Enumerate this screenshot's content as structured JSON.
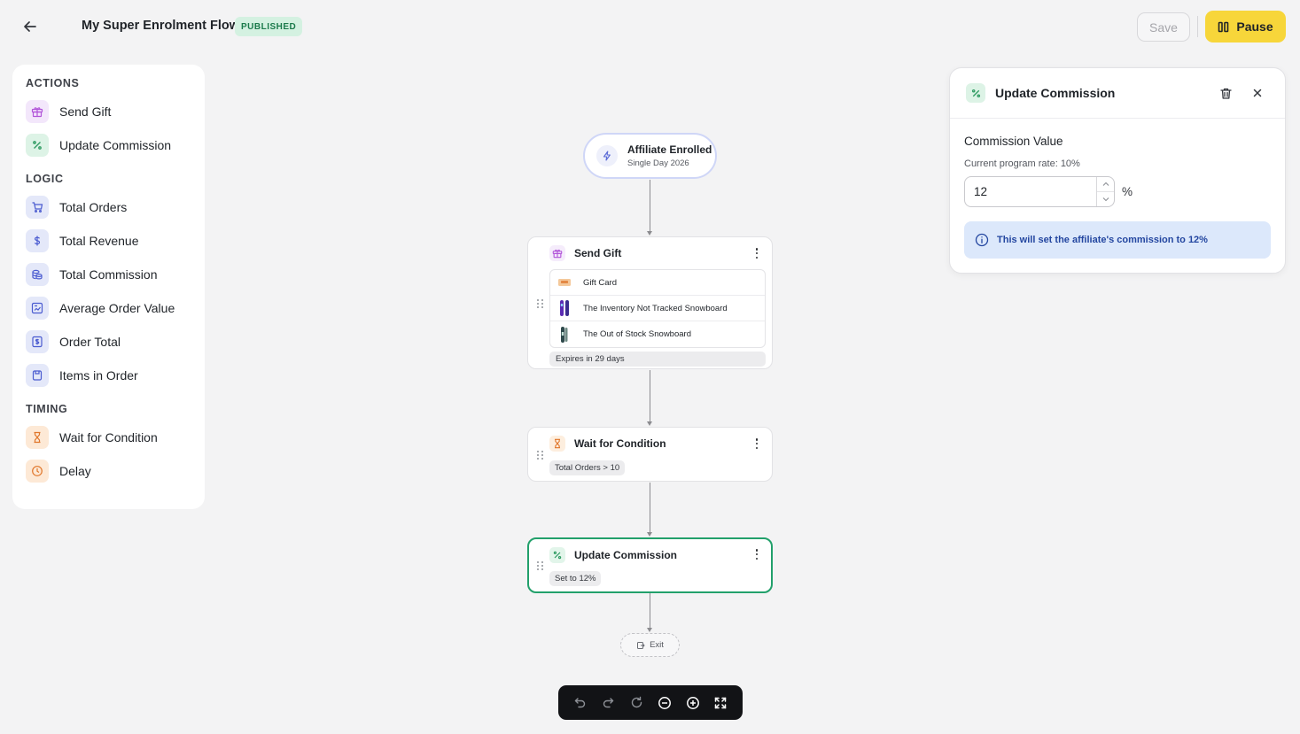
{
  "header": {
    "flow_title": "My Super Enrolment Flow",
    "status_badge": "PUBLISHED",
    "save_label": "Save",
    "pause_label": "Pause"
  },
  "sidebar": {
    "sections": [
      {
        "title": "ACTIONS",
        "items": [
          {
            "label": "Send Gift",
            "icon": "gift-icon"
          },
          {
            "label": "Update Commission",
            "icon": "percent-icon"
          }
        ]
      },
      {
        "title": "LOGIC",
        "items": [
          {
            "label": "Total Orders",
            "icon": "cart-icon"
          },
          {
            "label": "Total Revenue",
            "icon": "dollar-icon"
          },
          {
            "label": "Total Commission",
            "icon": "coins-icon"
          },
          {
            "label": "Average Order Value",
            "icon": "chart-icon"
          },
          {
            "label": "Order Total",
            "icon": "receipt-icon"
          },
          {
            "label": "Items in Order",
            "icon": "box-icon"
          }
        ]
      },
      {
        "title": "TIMING",
        "items": [
          {
            "label": "Wait for Condition",
            "icon": "hourglass-icon"
          },
          {
            "label": "Delay",
            "icon": "clock-icon"
          }
        ]
      }
    ]
  },
  "canvas": {
    "trigger": {
      "title": "Affiliate Enrolled",
      "subtitle": "Single Day 2026"
    },
    "send_gift": {
      "title": "Send Gift",
      "items": [
        "Gift Card",
        "The Inventory Not Tracked Snowboard",
        "The Out of Stock Snowboard"
      ],
      "expires": "Expires in 29 days"
    },
    "wait_node": {
      "title": "Wait for Condition",
      "condition": "Total Orders > 10"
    },
    "update_node": {
      "title": "Update Commission",
      "summary": "Set to 12%"
    },
    "exit_label": "Exit"
  },
  "panel": {
    "title": "Update Commission",
    "field_label": "Commission Value",
    "help_text": "Current program rate: 10%",
    "value": "12",
    "suffix": "%",
    "info": "This will set the affiliate's commission to 12%"
  },
  "colors": {
    "accent_yellow": "#f7d63a",
    "selected_node_border": "#22a06b",
    "published_badge": "#d4f1e1",
    "info_background": "#dce8fb"
  }
}
